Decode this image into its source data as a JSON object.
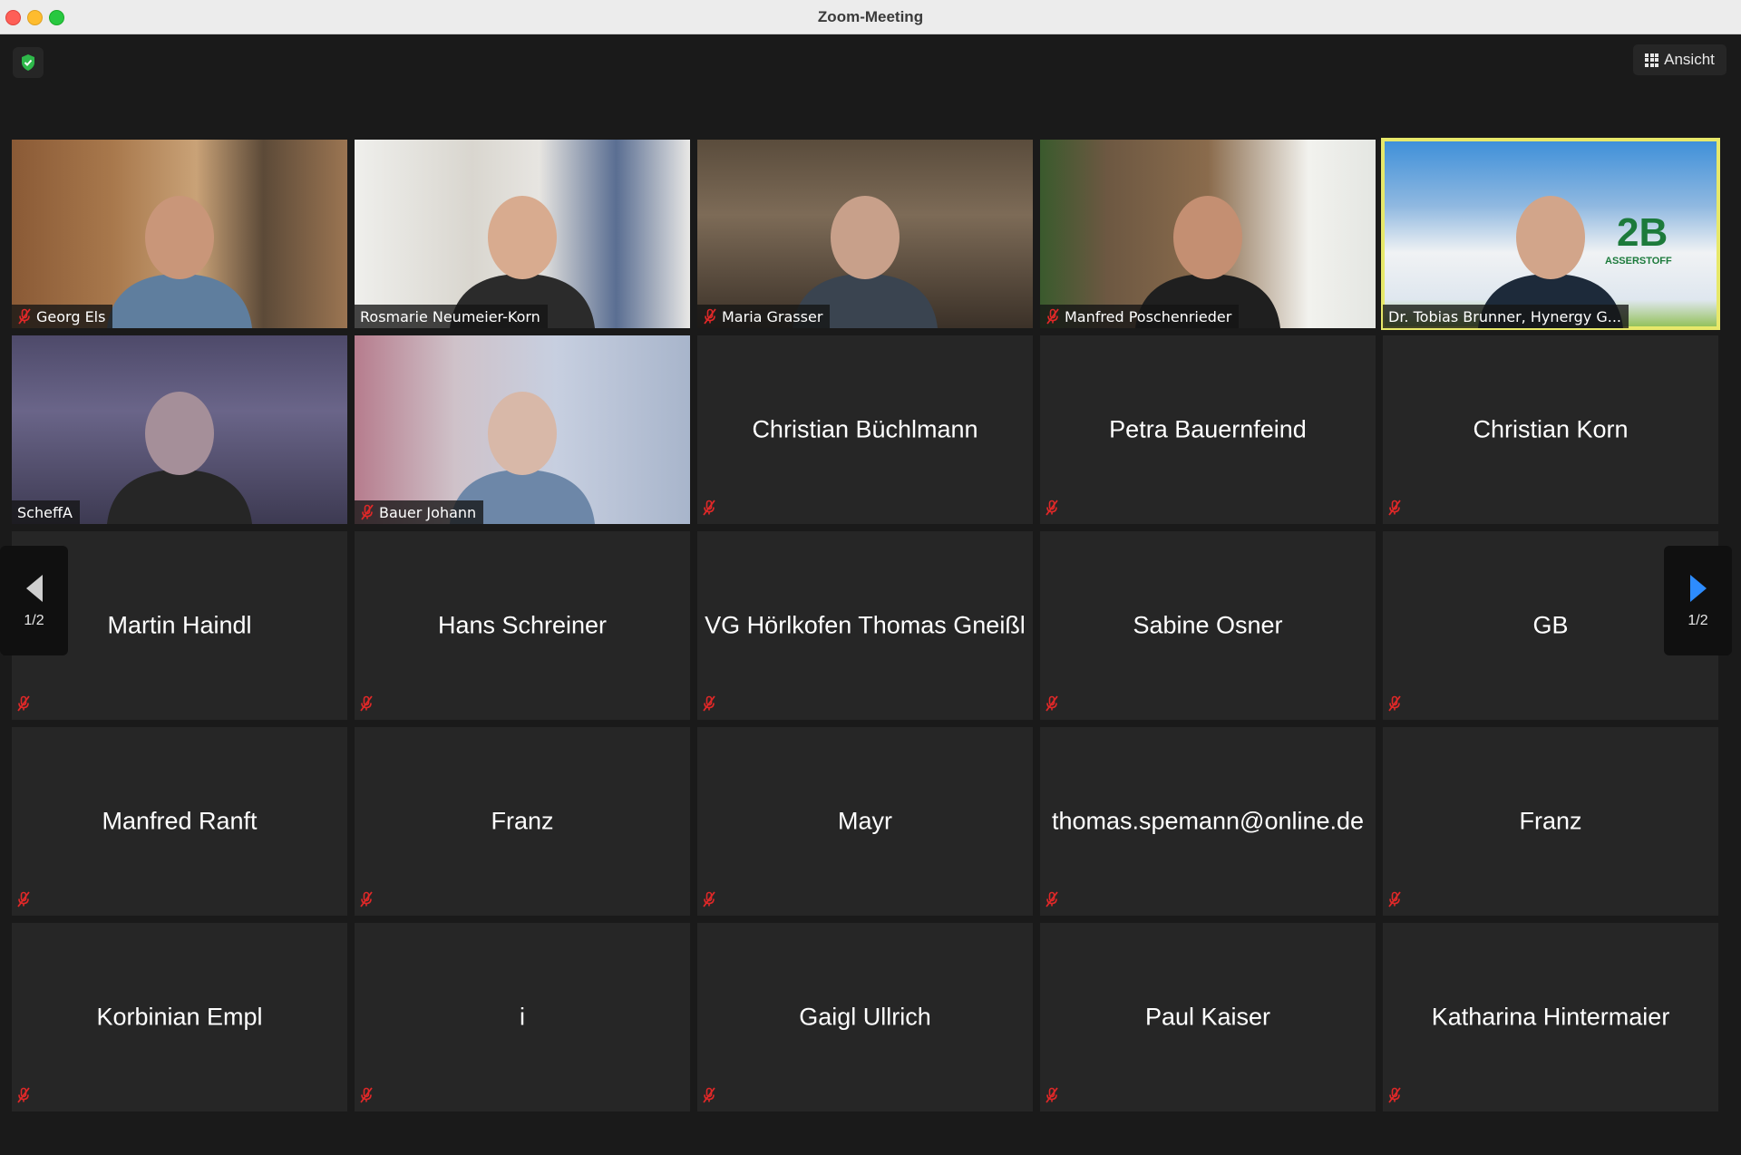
{
  "window": {
    "title": "Zoom-Meeting"
  },
  "toolbar": {
    "view_label": "Ansicht"
  },
  "pagination": {
    "left_label": "1/2",
    "right_label": "1/2"
  },
  "video_participants": [
    {
      "name": "Georg Els",
      "muted": true
    },
    {
      "name": "Rosmarie Neumeier-Korn",
      "muted": false
    },
    {
      "name": "Maria Grasser",
      "muted": true
    },
    {
      "name": "Manfred Poschenrieder",
      "muted": true
    },
    {
      "name": "Dr. Tobias Brunner, Hynergy G...",
      "muted": false,
      "active_speaker": true
    },
    {
      "name": "ScheffA",
      "muted": false
    },
    {
      "name": "Bauer Johann",
      "muted": true
    }
  ],
  "name_participants": [
    "Christian Büchlmann",
    "Petra Bauernfeind",
    "Christian Korn",
    "Martin Haindl",
    "Hans Schreiner",
    "VG Hörlkofen Thomas Gneißl",
    "Sabine Osner",
    "GB",
    "Manfred Ranft",
    "Franz",
    "Mayr",
    "thomas.spemann@online.de",
    "Franz",
    "Korbinian Empl",
    "i",
    "Gaigl Ullrich",
    "Paul Kaiser",
    "Katharina Hintermaier"
  ],
  "video_tile_logo_text": "2B",
  "video_tile_logo_subtext": "ASSERSTOFF",
  "colors": {
    "active_speaker_border": "#e7e86a",
    "muted_icon": "#e02828",
    "nav_arrow_active": "#2d8cff"
  }
}
